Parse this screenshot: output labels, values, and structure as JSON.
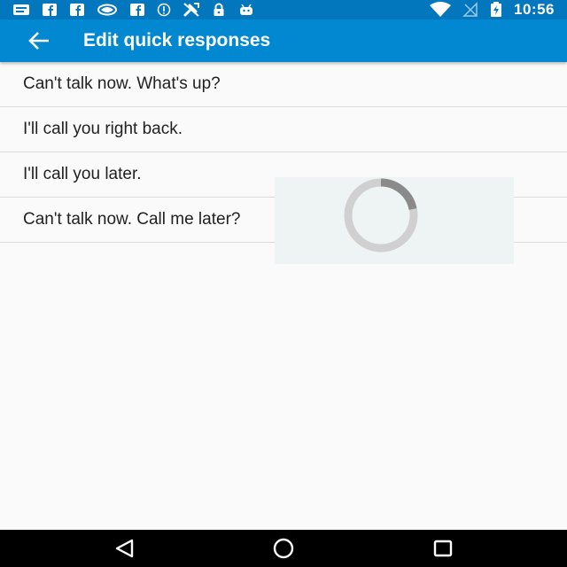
{
  "status_bar": {
    "time": "10:56",
    "left_icons": [
      "notification-icon",
      "facebook-icon",
      "facebook-icon",
      "signal-app-icon",
      "facebook-icon",
      "info-icon",
      "crossed-tool-icon",
      "lock-icon",
      "android-icon"
    ],
    "right_icons": [
      "wifi-icon",
      "no-signal-icon",
      "battery-charging-icon"
    ]
  },
  "app_bar": {
    "title": "Edit quick responses",
    "background": "#0288d1",
    "back_icon": "arrow-back-icon"
  },
  "responses": [
    "Can't talk now. What's up?",
    "I'll call you right back.",
    "I'll call you later.",
    "Can't talk now. Call me later?"
  ],
  "progress": {
    "icon": "loading-spinner-icon"
  },
  "nav_bar": {
    "icons": [
      "back-triangle-icon",
      "home-circle-icon",
      "recents-square-icon"
    ]
  }
}
